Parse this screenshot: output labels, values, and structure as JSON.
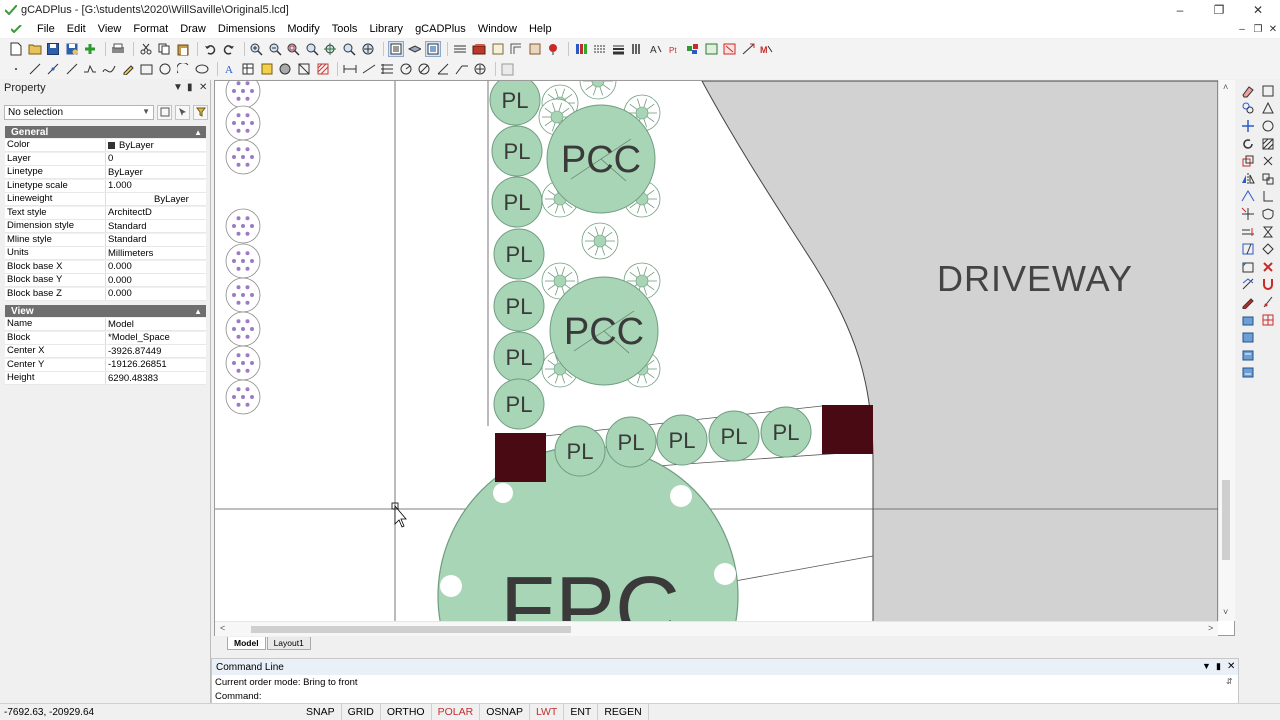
{
  "window": {
    "title": "gCADPlus - [G:\\students\\2020\\WillSaville\\Original5.lcd]",
    "controls": [
      "minimize",
      "restore",
      "close"
    ]
  },
  "menu": [
    "File",
    "Edit",
    "View",
    "Format",
    "Draw",
    "Dimensions",
    "Modify",
    "Tools",
    "Library",
    "gCADPlus",
    "Window",
    "Help"
  ],
  "property_panel": {
    "header": "Property",
    "selection": "No selection",
    "general": {
      "title": "General",
      "rows": [
        {
          "key": "Color",
          "value": "ByLayer"
        },
        {
          "key": "Layer",
          "value": "0"
        },
        {
          "key": "Linetype",
          "value": "ByLayer"
        },
        {
          "key": "Linetype scale",
          "value": "1.000"
        },
        {
          "key": "Lineweight",
          "value": "ByLayer"
        },
        {
          "key": "Text style",
          "value": "ArchitectD"
        },
        {
          "key": "Dimension style",
          "value": "Standard"
        },
        {
          "key": "Mline style",
          "value": "Standard"
        },
        {
          "key": "Units",
          "value": "Millimeters"
        },
        {
          "key": "Block base X",
          "value": "0.000"
        },
        {
          "key": "Block base Y",
          "value": "0.000"
        },
        {
          "key": "Block base Z",
          "value": "0.000"
        }
      ]
    },
    "view": {
      "title": "View",
      "rows": [
        {
          "key": "Name",
          "value": "Model"
        },
        {
          "key": "Block",
          "value": "*Model_Space"
        },
        {
          "key": "Center X",
          "value": "-3926.87449"
        },
        {
          "key": "Center Y",
          "value": "-19126.26851"
        },
        {
          "key": "Height",
          "value": "6290.48383"
        }
      ]
    }
  },
  "drawing": {
    "driveway_label": "DRIVEWAY",
    "pl": "PL",
    "pcc": "PCC",
    "fpc": "FPC",
    "colors": {
      "plant_fill": "#a8d5b6",
      "plant_stroke": "#6e9c7e",
      "driveway": "#d2d2d2",
      "post": "#4a0a14",
      "shrub": "#9c7bc4"
    }
  },
  "layout_tabs": [
    "Model",
    "Layout1"
  ],
  "command_line": {
    "title": "Command Line",
    "history": "Current order mode:  Bring to front",
    "prompt": "Command:"
  },
  "status": {
    "coords": "-7692.63,  -20929.64",
    "buttons": [
      {
        "label": "SNAP",
        "on": false
      },
      {
        "label": "GRID",
        "on": false
      },
      {
        "label": "ORTHO",
        "on": false
      },
      {
        "label": "POLAR",
        "on": true
      },
      {
        "label": "OSNAP",
        "on": false
      },
      {
        "label": "LWT",
        "on": true
      },
      {
        "label": "ENT",
        "on": false
      },
      {
        "label": "REGEN",
        "on": false
      }
    ]
  }
}
